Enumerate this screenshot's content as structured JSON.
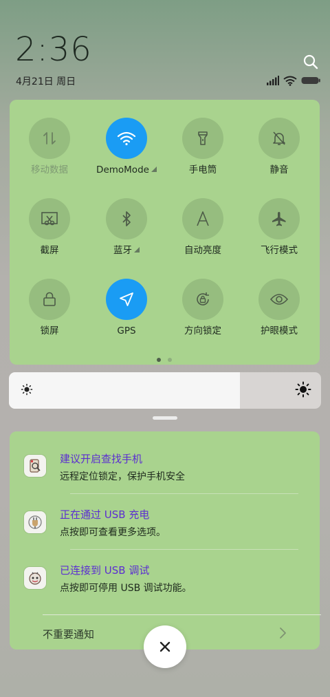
{
  "status_bar": {
    "time": "2:36",
    "date": "4月21日 周日"
  },
  "toggles": [
    {
      "label": "移动数据",
      "icon": "mobile-data-icon",
      "state": "disabled"
    },
    {
      "label": "DemoMode",
      "icon": "wifi-icon",
      "state": "on",
      "expandable": true
    },
    {
      "label": "手电筒",
      "icon": "flashlight-icon",
      "state": "off"
    },
    {
      "label": "静音",
      "icon": "mute-bell-icon",
      "state": "off"
    },
    {
      "label": "截屏",
      "icon": "screenshot-icon",
      "state": "off"
    },
    {
      "label": "蓝牙",
      "icon": "bluetooth-icon",
      "state": "off",
      "expandable": true
    },
    {
      "label": "自动亮度",
      "icon": "auto-brightness-icon",
      "state": "off"
    },
    {
      "label": "飞行模式",
      "icon": "airplane-icon",
      "state": "off"
    },
    {
      "label": "锁屏",
      "icon": "lock-icon",
      "state": "off"
    },
    {
      "label": "GPS",
      "icon": "location-arrow-icon",
      "state": "on"
    },
    {
      "label": "方向锁定",
      "icon": "rotation-lock-icon",
      "state": "off"
    },
    {
      "label": "护眼模式",
      "icon": "eye-icon",
      "state": "off"
    }
  ],
  "pager": {
    "pages": 2,
    "current": 1
  },
  "brightness": {
    "level": 0.74
  },
  "notifications": [
    {
      "title": "建议开启查找手机",
      "body": "远程定位锁定，保护手机安全",
      "icon": "find-phone-app-icon"
    },
    {
      "title": "正在通过 USB 充电",
      "body": "点按即可查看更多选项。",
      "icon": "android-system-app-icon"
    },
    {
      "title": "已连接到 USB 调试",
      "body": "点按即可停用 USB 调试功能。",
      "icon": "android-debug-app-icon"
    }
  ],
  "footer": {
    "unimportant_label": "不重要通知"
  },
  "colors": {
    "panel": "#a9d38e",
    "accent_on": "#1a9cf4",
    "notification_title": "#5b2ed1"
  }
}
